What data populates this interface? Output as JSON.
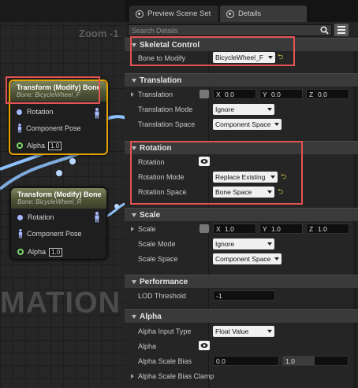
{
  "graph": {
    "zoom_label": "Zoom -1",
    "watermark": "MATION",
    "nodes": [
      {
        "title": "Transform (Modify) Bone",
        "subtitle": "Bone: BicycleWheel_F",
        "selected": true,
        "pins": [
          {
            "label": "Rotation"
          },
          {
            "label": "Component Pose"
          },
          {
            "label": "Alpha",
            "value": "1.0"
          }
        ]
      },
      {
        "title": "Transform (Modify) Bone",
        "subtitle": "Bone: BicycleWheel_R",
        "selected": false,
        "pins": [
          {
            "label": "Rotation"
          },
          {
            "label": "Component Pose"
          },
          {
            "label": "Alpha",
            "value": "1.0"
          }
        ]
      }
    ]
  },
  "tabs": [
    {
      "label": "Preview Scene Set",
      "icon": "preview-scene-icon"
    },
    {
      "label": "Details",
      "icon": "details-icon"
    }
  ],
  "search": {
    "placeholder": "Search Details"
  },
  "sections": {
    "skeletal": {
      "title": "Skeletal Control",
      "bone_label": "Bone to Modify",
      "bone_value": "BicycleWheel_F"
    },
    "translation": {
      "title": "Translation",
      "translation_label": "Translation",
      "x": "0.0",
      "y": "0.0",
      "z": "0.0",
      "mode_label": "Translation Mode",
      "mode_value": "Ignore",
      "space_label": "Translation Space",
      "space_value": "Component Space"
    },
    "rotation": {
      "title": "Rotation",
      "rotation_label": "Rotation",
      "mode_label": "Rotation Mode",
      "mode_value": "Replace Existing",
      "space_label": "Rotation Space",
      "space_value": "Bone Space"
    },
    "scale": {
      "title": "Scale",
      "scale_label": "Scale",
      "x": "1.0",
      "y": "1.0",
      "z": "1.0",
      "mode_label": "Scale Mode",
      "mode_value": "Ignore",
      "space_label": "Scale Space",
      "space_value": "Component Space"
    },
    "performance": {
      "title": "Performance",
      "lod_label": "LOD Threshold",
      "lod_value": "-1"
    },
    "alpha": {
      "title": "Alpha",
      "input_type_label": "Alpha Input Type",
      "input_type_value": "Float Value",
      "alpha_label": "Alpha",
      "scale_bias_label": "Alpha Scale Bias",
      "scale_bias_min": "0.0",
      "scale_bias_max": "1.0",
      "clamp_label": "Alpha Scale Bias Clamp"
    }
  },
  "axes": {
    "x": "X",
    "y": "Y",
    "z": "Z"
  },
  "colors": {
    "highlight_box": "#e45353",
    "selected_node_border": "#e4a200",
    "reset_arrow": "#d7c23b"
  }
}
